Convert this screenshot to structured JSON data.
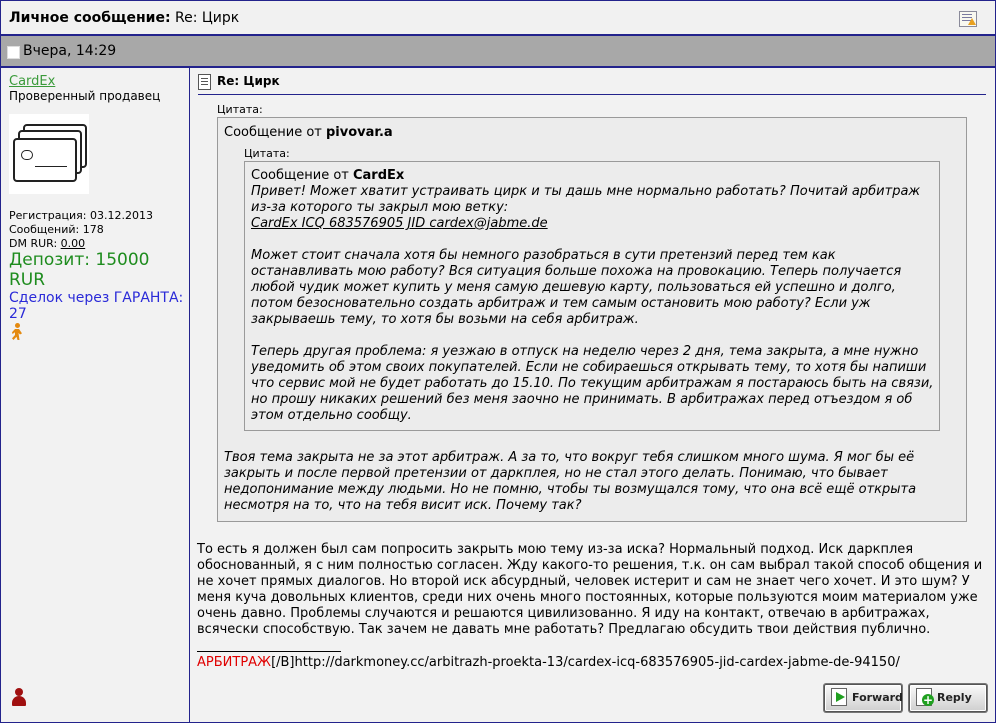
{
  "header": {
    "title_label": "Личное сообщение:",
    "title_subject": "Re: Цирк"
  },
  "datebar": {
    "date": "Вчера, 14:29"
  },
  "author": {
    "name": "CardEx",
    "role": "Проверенный продавец",
    "registration": "Регистрация: 03.12.2013",
    "messages": "Сообщений: 178",
    "dm_label": "DM RUR: ",
    "dm_value": "0.00",
    "deposit": "Депозит: 15000 RUR",
    "garant": "Сделок через ГАРАНТА: 27"
  },
  "post": {
    "subject": "Re: Цирк",
    "quote_label": "Цитата:",
    "quote1": {
      "from_prefix": "Сообщение от ",
      "from_name": "pivovar.a",
      "body": "Твоя тема закрыта не за этот арбитраж. А за то, что вокруг тебя слишком много шума. Я мог бы её закрыть и после первой претензии от даркплея, но не стал этого делать. Понимаю, что бывает недопонимание между людьми. Но не помню, чтобы ты возмущался тому, что она всё ещё открыта несмотря на то, что на тебя висит иск. Почему так?"
    },
    "quote2": {
      "from_prefix": "Сообщение от ",
      "from_name": "CardEx",
      "para1": "Привет! Может хватит устраивать цирк и ты дашь мне нормально работать? Почитай арбитраж из-за которого ты закрыл мою ветку:",
      "link": "CardEx ICQ 683576905 JID cardex@jabme.de",
      "para2": "Может стоит сначала хотя бы немного разобраться в сути претензий перед тем как останавливать мою работу? Вся ситуация больше похожа на провокацию. Теперь получается любой чудик может купить у меня самую дешевую карту, пользоваться ей успешно и долго, потом безосновательно создать арбитраж и тем самым остановить мою работу? Если уж закрываешь тему, то хотя бы возьми на себя арбитраж.",
      "para3": "Теперь другая проблема: я уезжаю в отпуск на неделю через 2 дня, тема закрыта, а мне нужно уведомить об этом своих покупателей. Если не собираешься открывать тему, то хотя бы напиши что сервис мой не будет работать до 15.10. По текущим арбитражам я постараюсь быть на связи, но прошу никаких решений без меня заочно не принимать. В арбитражах перед отъездом я об этом отдельно сообщу."
    },
    "reply": "То есть я должен был сам попросить закрыть мою тему из-за иска? Нормальный подход. Иск даркплея обоснованный, я с ним полностью согласен. Жду какого-то решения, т.к. он сам выбрал такой способ общения и не хочет прямых диалогов. Но второй иск абсурдный, человек истерит и сам не знает чего хочет. И это шум? У меня куча довольных клиентов, среди них очень много постоянных, которые пользуются моим материалом уже очень давно. Проблемы случаются и решаются цивилизованно. Я иду на контакт, отвечаю в арбитражах, всячески способствую. Так зачем не давать мне работать? Предлагаю обсудить твои действия публично.",
    "signature_red": "АРБИТРАЖ",
    "signature_rest": "[/B]http://darkmoney.cc/arbitrazh-proekta-13/cardex-icq-683576905-jid-cardex-jabme-de-94150/"
  },
  "buttons": {
    "forward": "Forward",
    "reply": "Reply"
  },
  "icons": [
    "report-icon",
    "checkbox-icon",
    "document-icon",
    "runner-icon",
    "user-offline-icon",
    "forward-icon",
    "reply-icon"
  ]
}
